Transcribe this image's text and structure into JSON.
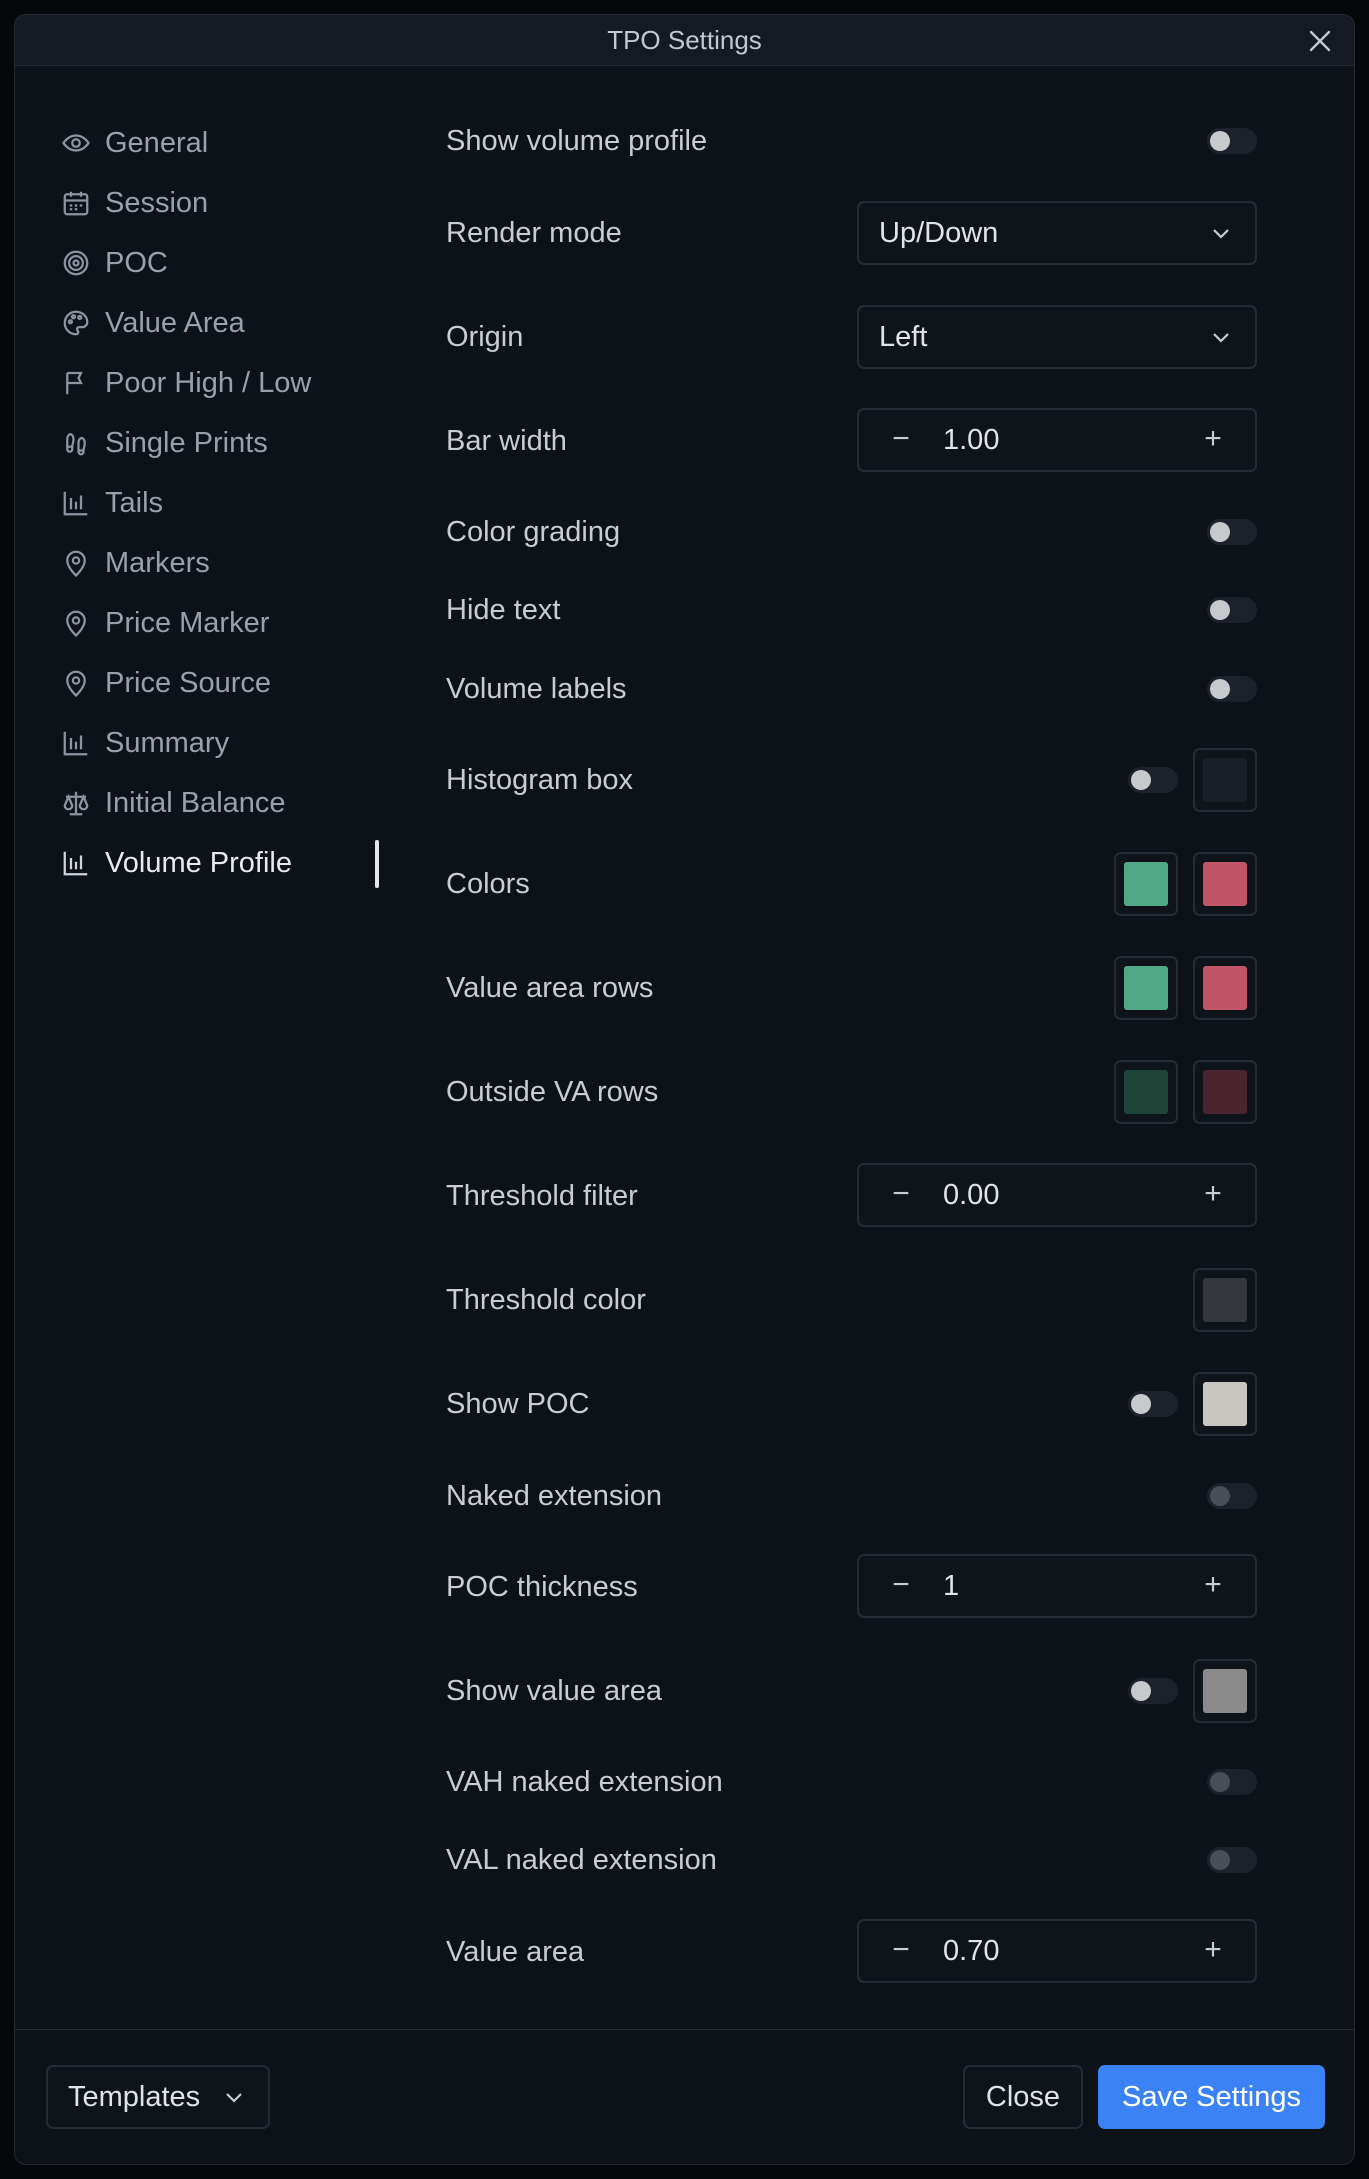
{
  "dialog": {
    "title": "TPO Settings"
  },
  "sidebar": {
    "items": [
      {
        "label": "General",
        "icon": "eye-icon"
      },
      {
        "label": "Session",
        "icon": "calendar-icon"
      },
      {
        "label": "POC",
        "icon": "target-icon"
      },
      {
        "label": "Value Area",
        "icon": "palette-icon"
      },
      {
        "label": "Poor High / Low",
        "icon": "flag-icon"
      },
      {
        "label": "Single Prints",
        "icon": "footprints-icon"
      },
      {
        "label": "Tails",
        "icon": "bar-chart-icon"
      },
      {
        "label": "Markers",
        "icon": "map-pin-icon"
      },
      {
        "label": "Price Marker",
        "icon": "map-pin-icon"
      },
      {
        "label": "Price Source",
        "icon": "map-pin-icon"
      },
      {
        "label": "Summary",
        "icon": "bar-chart-icon"
      },
      {
        "label": "Initial Balance",
        "icon": "scale-icon"
      },
      {
        "label": "Volume Profile",
        "icon": "bar-chart-icon"
      }
    ],
    "active": "Volume Profile"
  },
  "settings": {
    "show_volume_profile": {
      "label": "Show volume profile",
      "enabled": false
    },
    "render_mode": {
      "label": "Render mode",
      "value": "Up/Down"
    },
    "origin": {
      "label": "Origin",
      "value": "Left"
    },
    "bar_width": {
      "label": "Bar width",
      "value": "1.00"
    },
    "color_grading": {
      "label": "Color grading",
      "enabled": false
    },
    "hide_text": {
      "label": "Hide text",
      "enabled": false
    },
    "volume_labels": {
      "label": "Volume labels",
      "enabled": false
    },
    "histogram_box": {
      "label": "Histogram box",
      "enabled": false,
      "color": "#1a1e26"
    },
    "colors": {
      "label": "Colors",
      "up": "#4fa886",
      "down": "#c05568"
    },
    "value_area_rows": {
      "label": "Value area rows",
      "up": "#4fa886",
      "down": "#c05568"
    },
    "outside_va_rows": {
      "label": "Outside VA rows",
      "up": "#1f4438",
      "down": "#4a2530"
    },
    "threshold_filter": {
      "label": "Threshold filter",
      "value": "0.00"
    },
    "threshold_color": {
      "label": "Threshold color",
      "color": "#34373d"
    },
    "show_poc": {
      "label": "Show POC",
      "enabled": false,
      "color": "#c8c6c1"
    },
    "naked_extension": {
      "label": "Naked extension",
      "enabled": false
    },
    "poc_thickness": {
      "label": "POC thickness",
      "value": "1"
    },
    "show_value_area": {
      "label": "Show value area",
      "enabled": false,
      "color": "#8a8a8a"
    },
    "vah_naked_extension": {
      "label": "VAH naked extension",
      "enabled": false
    },
    "val_naked_extension": {
      "label": "VAL naked extension",
      "enabled": false
    },
    "value_area": {
      "label": "Value area",
      "value": "0.70"
    }
  },
  "stepper": {
    "minus": "−",
    "plus": "+"
  },
  "footer": {
    "templates_label": "Templates",
    "close_label": "Close",
    "save_label": "Save Settings"
  },
  "colors": {
    "accent": "#3b82f6",
    "background": "#0d1118",
    "border": "#262b35"
  }
}
